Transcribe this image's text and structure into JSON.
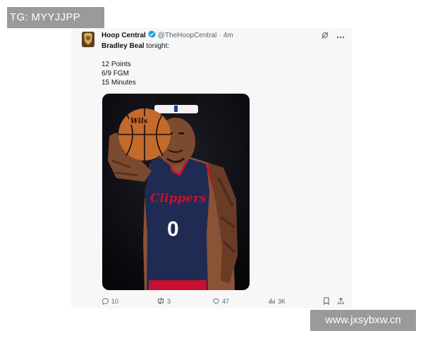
{
  "overlay": {
    "top_left": "TG: MYYJJPP",
    "bottom_right": "www.jxsybxw.cn"
  },
  "post": {
    "author_name": "Hoop Central",
    "handle": "@TheHoopCentral",
    "separator": "·",
    "time": "4m",
    "verified": true,
    "accent_color": "#1d9bf0",
    "text": {
      "player": "Bradley Beal",
      "suffix": " tonight:",
      "stats": [
        "12 Points",
        "6/9 FGM",
        "15 Minutes"
      ]
    },
    "image": {
      "icon": "player-photo",
      "jersey_wordmark": "Clippers",
      "jersey_number": "0"
    },
    "actions": {
      "replies": "10",
      "reposts": "3",
      "likes": "47",
      "views": "3K"
    }
  }
}
